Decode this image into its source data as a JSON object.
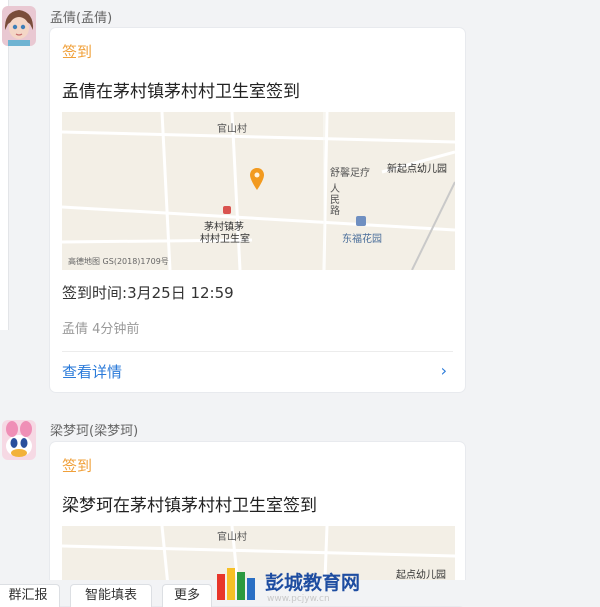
{
  "messages": [
    {
      "sender": "孟倩(孟倩)",
      "card": {
        "type": "签到",
        "title": "孟倩在茅村镇茅村村卫生室签到",
        "map": {
          "labels": {
            "top_village": "官山村",
            "road1": "舒馨足疗",
            "road2": "人民路",
            "poi1": "新起点幼儿园",
            "poi2": "东福花园"
          },
          "poi_main_line1": "茅村镇茅",
          "poi_main_line2": "村村卫生室",
          "copyright": "高德地图  GS(2018)1709号"
        },
        "checkin_label": "签到时间:",
        "checkin_time": "3月25日 12:59",
        "meta_user": "孟倩",
        "meta_time": "4分钟前",
        "detail_link": "查看详情"
      }
    },
    {
      "sender": "梁梦珂(梁梦珂)",
      "card": {
        "type": "签到",
        "title": "梁梦珂在茅村镇茅村村卫生室签到",
        "map": {
          "labels": {
            "top_village": "官山村",
            "poi1": "起点幼儿园"
          }
        }
      }
    }
  ],
  "bottom_bar": {
    "btn1": "群汇报",
    "btn2": "智能填表",
    "btn3": "更多"
  },
  "watermark": {
    "text": "彭城教育网",
    "url": "www.pcjyw.cn"
  },
  "colors": {
    "accent_orange": "#f0a03a",
    "link_blue": "#2a7ad9",
    "map_bg": "#f3efe6"
  }
}
